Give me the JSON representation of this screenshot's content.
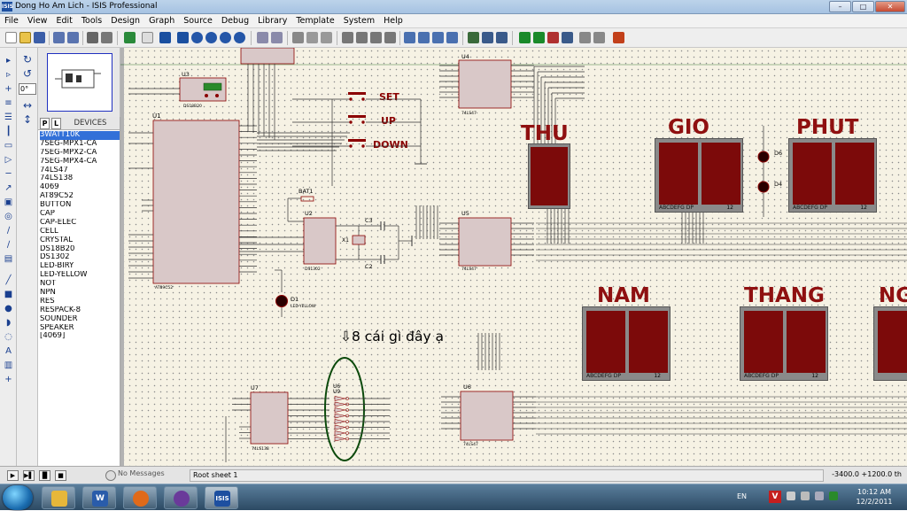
{
  "window": {
    "title": "Dong Ho Am Lich - ISIS Professional",
    "app_icon_text": "ISIS",
    "min": "–",
    "max": "□",
    "close": "✕"
  },
  "menu": [
    "File",
    "View",
    "Edit",
    "Tools",
    "Design",
    "Graph",
    "Source",
    "Debug",
    "Library",
    "Template",
    "System",
    "Help"
  ],
  "devices": {
    "tab_p": "P",
    "tab_l": "L",
    "header": "DEVICES",
    "items": [
      "3WATT10K",
      "7SEG-MPX1-CA",
      "7SEG-MPX2-CA",
      "7SEG-MPX4-CA",
      "74LS47",
      "74LS138",
      "4069",
      "AT89C52",
      "BUTTON",
      "CAP",
      "CAP-ELEC",
      "CELL",
      "CRYSTAL",
      "DS18B20",
      "DS1302",
      "LED-BIRY",
      "LED-YELLOW",
      "NOT",
      "NPN",
      "RES",
      "RESPACK-8",
      "SOUNDER",
      "SPEAKER",
      "[4069]"
    ],
    "selected_index": 0
  },
  "rotation": {
    "angle": "0°"
  },
  "schematic": {
    "display_labels": {
      "thu": "THU",
      "gio": "GIO",
      "phut": "PHUT",
      "nam": "NAM",
      "thang": "THANG",
      "ngay": "NG"
    },
    "buttons": {
      "set": "SET",
      "up": "UP",
      "down": "DOWN"
    },
    "annotation": "⇩8 cái gì đây ạ",
    "parts": {
      "u1": "U1",
      "u1_type": "AT89C52",
      "u2": "U2",
      "u3": "U3",
      "u3_type": "DS18B20",
      "u4": "U4",
      "u5": "U5",
      "u6a": "U6",
      "u6b": "U6",
      "u7": "U7",
      "u7_type": "74LS138",
      "u8": "U9",
      "d1": "D1",
      "d1_type": "LED-YELLOW",
      "d6": "D6",
      "d4": "D4",
      "bat1": "BAT1",
      "x1": "X1",
      "c2": "C2",
      "c3": "C3",
      "ls47": "74LS47",
      "ds1302": "DS1302"
    },
    "seg_pins": "ABCDEFG  DP",
    "seg_12": "12"
  },
  "status": {
    "messages": "No Messages",
    "sheet": "Root sheet 1",
    "coords": "-3400.0  +1200.0",
    "coords_unit": "th"
  },
  "taskbar": {
    "lang": "EN",
    "time": "10:12 AM",
    "date": "12/2/2011",
    "tasks": [
      "folder",
      "word",
      "firefox",
      "media",
      "isis"
    ]
  }
}
